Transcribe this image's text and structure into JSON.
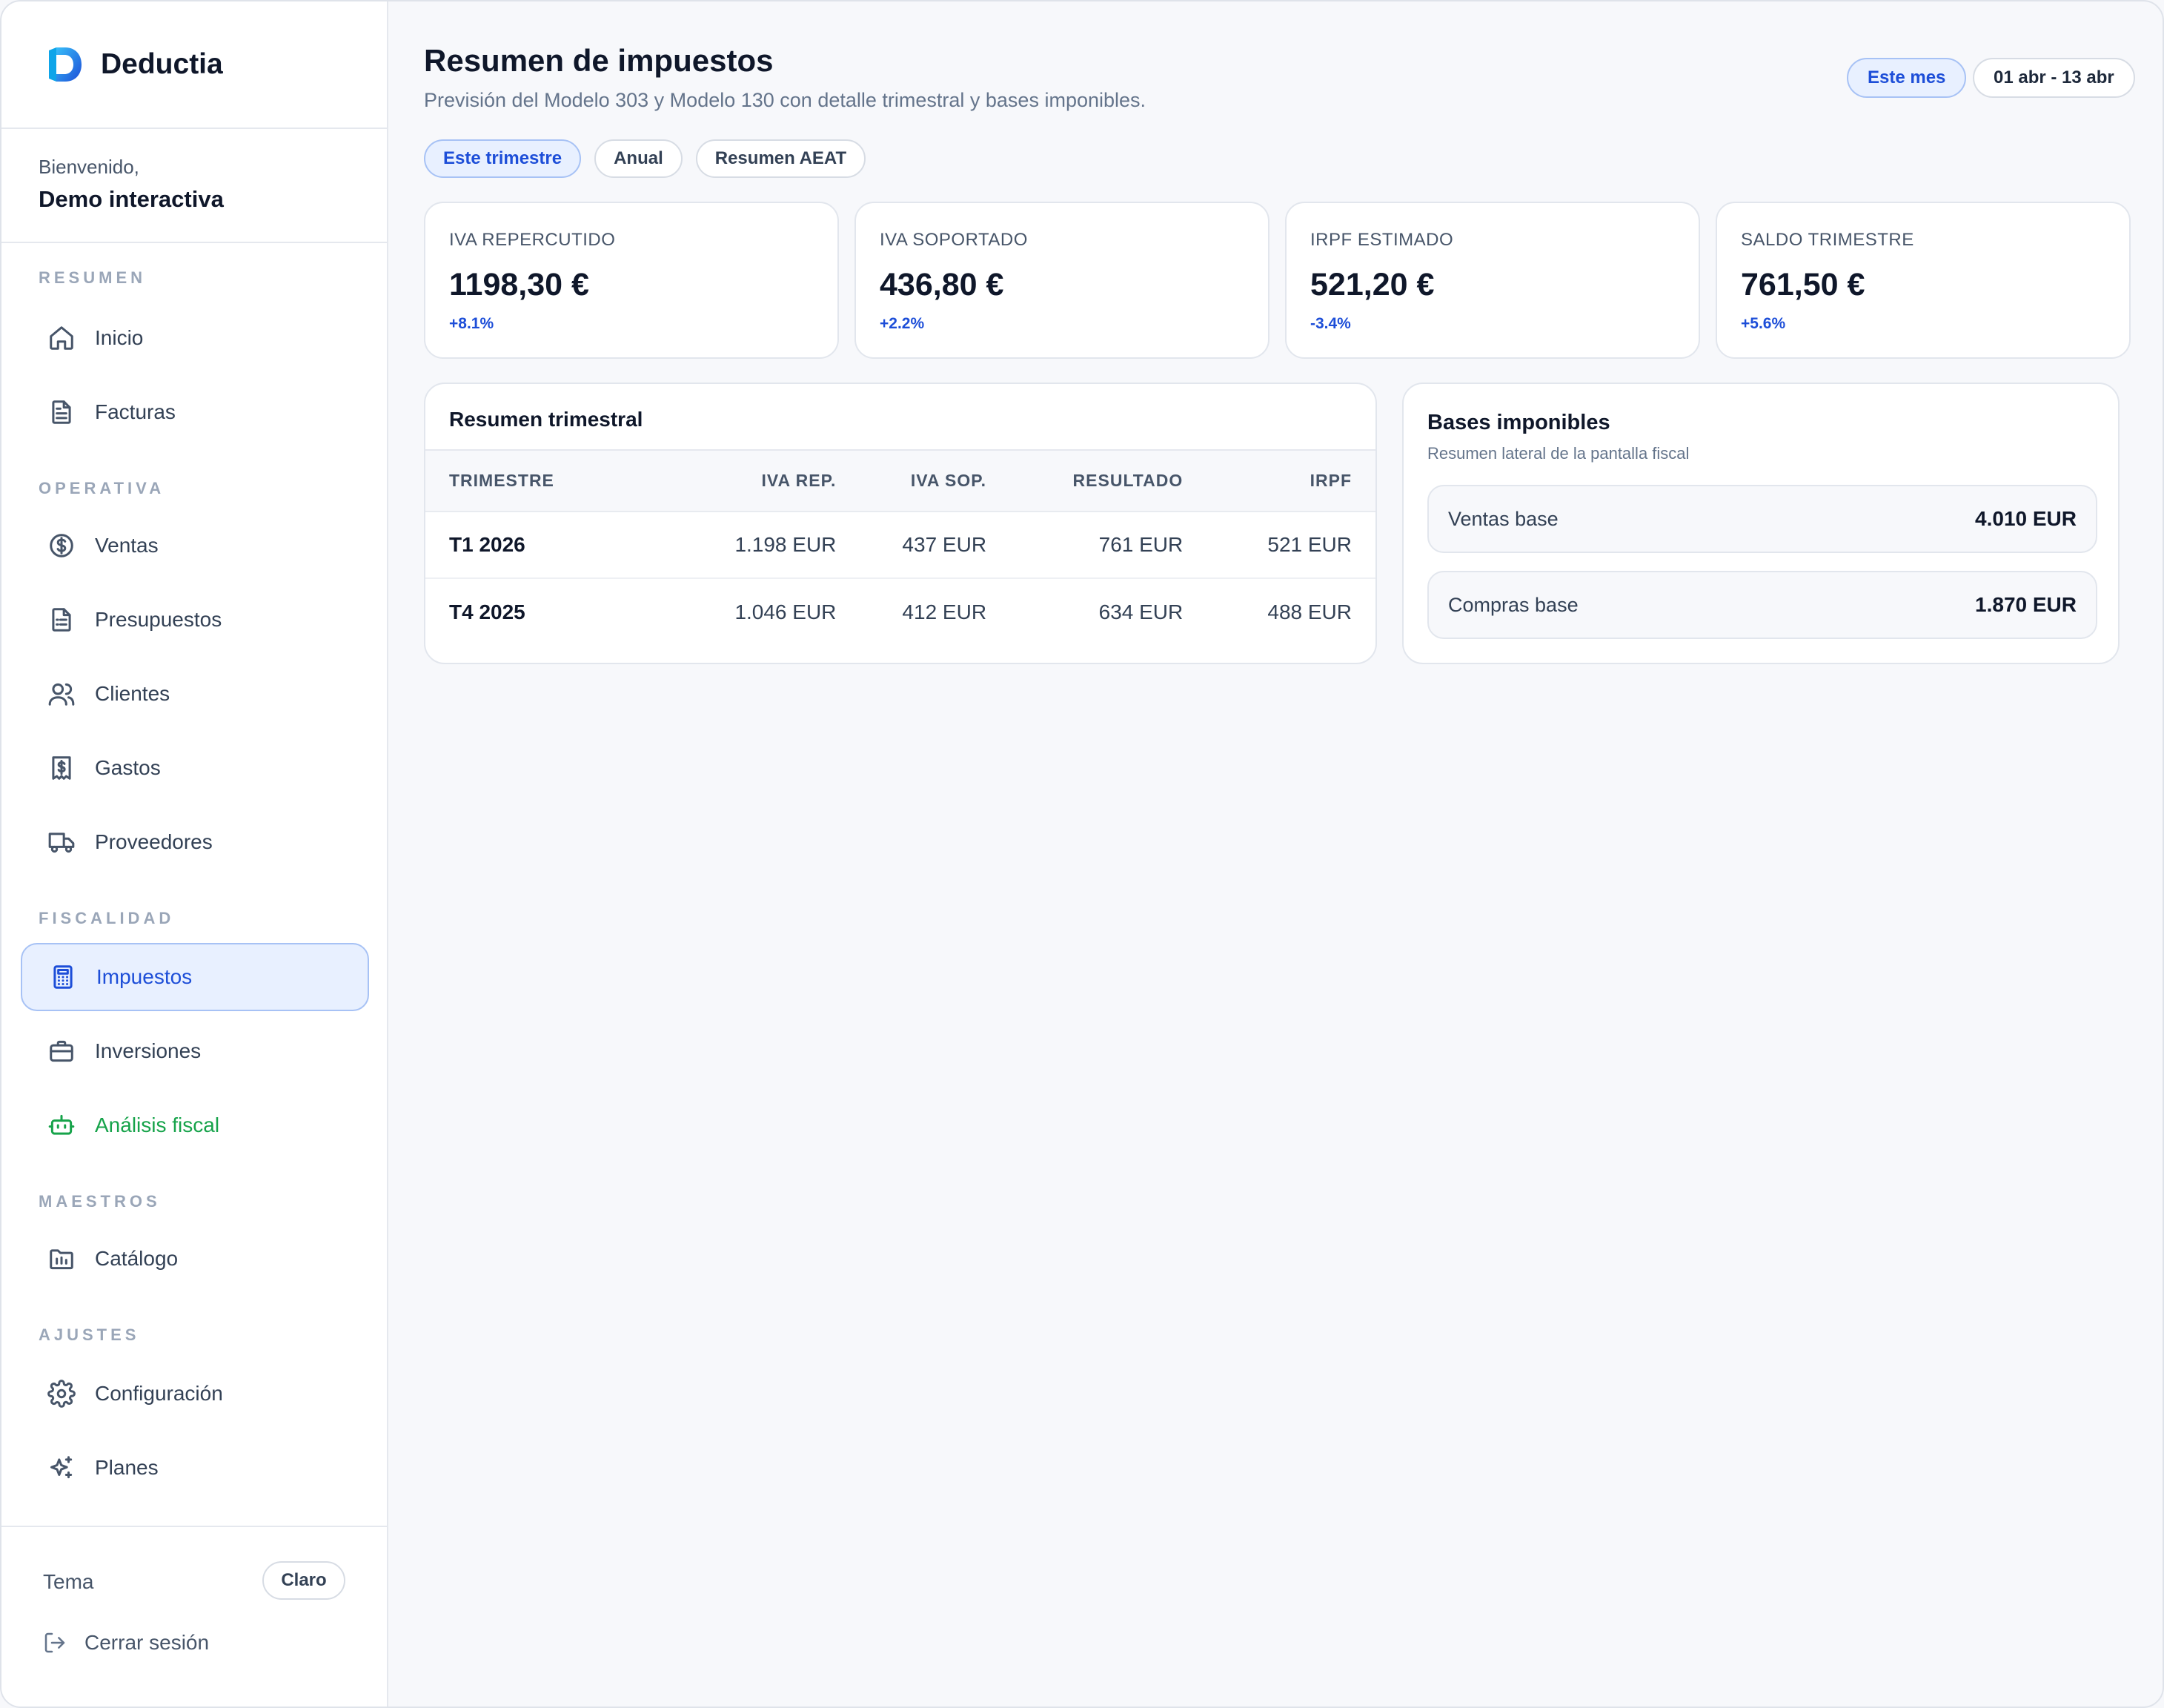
{
  "app": {
    "name": "Deductia"
  },
  "user": {
    "greeting": "Bienvenido,",
    "name": "Demo interactiva"
  },
  "sidebar": {
    "sections": [
      {
        "label": "RESUMEN",
        "items": [
          {
            "label": "Inicio",
            "icon": "home-icon"
          },
          {
            "label": "Facturas",
            "icon": "file-text-icon"
          }
        ]
      },
      {
        "label": "OPERATIVA",
        "items": [
          {
            "label": "Ventas",
            "icon": "dollar-circle-icon"
          },
          {
            "label": "Presupuestos",
            "icon": "file-list-icon"
          },
          {
            "label": "Clientes",
            "icon": "users-icon"
          },
          {
            "label": "Gastos",
            "icon": "receipt-icon"
          },
          {
            "label": "Proveedores",
            "icon": "truck-icon"
          }
        ]
      },
      {
        "label": "FISCALIDAD",
        "items": [
          {
            "label": "Impuestos",
            "icon": "calculator-icon",
            "active": true
          },
          {
            "label": "Inversiones",
            "icon": "briefcase-icon"
          },
          {
            "label": "Análisis fiscal",
            "icon": "bot-icon",
            "accent": "#16a34a"
          }
        ]
      },
      {
        "label": "MAESTROS",
        "items": [
          {
            "label": "Catálogo",
            "icon": "folder-chart-icon"
          }
        ]
      },
      {
        "label": "AJUSTES",
        "items": [
          {
            "label": "Configuración",
            "icon": "gear-icon"
          },
          {
            "label": "Planes",
            "icon": "sparkles-icon"
          }
        ]
      }
    ],
    "footer": {
      "theme_label": "Tema",
      "theme_value": "Claro",
      "logout_label": "Cerrar sesión"
    }
  },
  "header": {
    "title": "Resumen de impuestos",
    "subtitle": "Previsión del Modelo 303 y Modelo 130 con detalle trimestral y bases imponibles.",
    "period_label": "Este mes",
    "date_range": "01 abr - 13 abr"
  },
  "tabs": [
    {
      "label": "Este trimestre",
      "active": true
    },
    {
      "label": "Anual"
    },
    {
      "label": "Resumen AEAT"
    }
  ],
  "kpis": [
    {
      "label": "IVA REPERCUTIDO",
      "value": "1198,30 €",
      "delta": "+8.1%"
    },
    {
      "label": "IVA SOPORTADO",
      "value": "436,80 €",
      "delta": "+2.2%"
    },
    {
      "label": "IRPF ESTIMADO",
      "value": "521,20 €",
      "delta": "-3.4%"
    },
    {
      "label": "SALDO TRIMESTRE",
      "value": "761,50 €",
      "delta": "+5.6%"
    }
  ],
  "quarterly": {
    "title": "Resumen trimestral",
    "columns": [
      "TRIMESTRE",
      "IVA REP.",
      "IVA SOP.",
      "RESULTADO",
      "IRPF"
    ],
    "rows": [
      [
        "T1 2026",
        "1.198 EUR",
        "437 EUR",
        "761 EUR",
        "521 EUR"
      ],
      [
        "T4 2025",
        "1.046 EUR",
        "412 EUR",
        "634 EUR",
        "488 EUR"
      ]
    ]
  },
  "bases": {
    "title": "Bases imponibles",
    "subtitle": "Resumen lateral de la pantalla fiscal",
    "rows": [
      {
        "label": "Ventas base",
        "value": "4.010 EUR"
      },
      {
        "label": "Compras base",
        "value": "1.870 EUR"
      }
    ]
  },
  "colors": {
    "accent": "#1d4ed8",
    "accent_bg": "#e8f0ff",
    "green": "#16a34a"
  }
}
